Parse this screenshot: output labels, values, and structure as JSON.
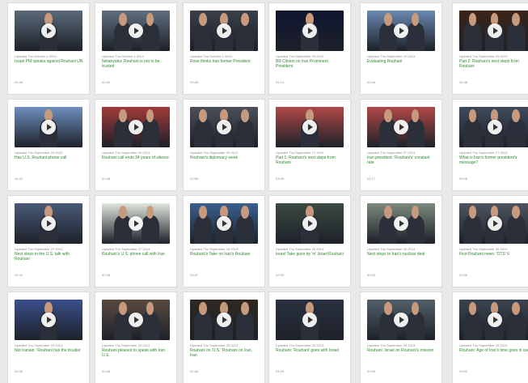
{
  "videos": [
    {
      "updated": "Updated Thu October 1 2013",
      "title": "Israel PM speaks against Rouhani UN",
      "duration": "01:48",
      "bg": "#5a6a7a"
    },
    {
      "updated": "Updated Thu October 1 2013",
      "title": "Netanyahu: Rouhani is not to be trusted",
      "duration": "02:30",
      "bg": "#5f6f7f"
    },
    {
      "updated": "Updated Thu October 1 2013",
      "title": "Rove thinks Iran former President",
      "duration": "03:45",
      "bg": "#3a3f48"
    },
    {
      "updated": "Updated Thu September 29 2013",
      "title": "Bill Clinton on Iran Prominent President",
      "duration": "02:14",
      "bg": "#0f1430"
    },
    {
      "updated": "Updated Thu September 29 2013",
      "title": "Evaluating Rouhani",
      "duration": "02:46",
      "bg": "#6a88b0"
    },
    {
      "updated": "Updated Thu September 29 2013",
      "title": "Part 2: Rouhani's next steps from Rouhani",
      "duration": "04:38",
      "bg": "#3c2418"
    },
    {
      "updated": "Updated Thu September 29 2013",
      "title": "Has U.S. Rouhani phone call",
      "duration": "01:42",
      "bg": "#6f8fbe"
    },
    {
      "updated": "Updated Thu September 29 2013",
      "title": "Rouhani call ends 34 years of silence",
      "duration": "01:48",
      "bg": "#a03a3a"
    },
    {
      "updated": "Updated Thu September 29 2013",
      "title": "Rouhani's diplomacy week",
      "duration": "01:56",
      "bg": "#4a4f58"
    },
    {
      "updated": "Updated Thu September 27 2013",
      "title": "Part 1: Rouhani's next steps from Rouhani",
      "duration": "03:45",
      "bg": "#b04848"
    },
    {
      "updated": "Updated Thu September 27 2013",
      "title": "Iran president: 'Rouhani's' constant rate",
      "duration": "01:17",
      "bg": "#b04848"
    },
    {
      "updated": "Updated Thu September 27 2013",
      "title": "What is Iran's former president's message?",
      "duration": "03:48",
      "bg": "#3e4a5c"
    },
    {
      "updated": "Updated Thu September 27 2013",
      "title": "Next steps in the U.S. talk with Rouhani",
      "duration": "01:44",
      "bg": "#4a5a78"
    },
    {
      "updated": "Updated Thu September 27 2013",
      "title": "Rouhani's U.S. phone call with Iran",
      "duration": "02:38",
      "bg": "#dfe6dc"
    },
    {
      "updated": "Updated Thu September 26 2013",
      "title": "Rouhani's Take on Iran's Rouhani",
      "duration": "03:47",
      "bg": "#3a5f8f"
    },
    {
      "updated": "Updated Thu September 26 2013",
      "title": "Israel Take goes by 'in' Israel Rouhani",
      "duration": "02:09",
      "bg": "#3c4a42"
    },
    {
      "updated": "Updated Thu September 26 2013",
      "title": "Next steps to Iran's nuclear deal",
      "duration": "02:40",
      "bg": "#7d8a7e"
    },
    {
      "updated": "Updated Thu September 26 2013",
      "title": "First Rouhani news: 'OTS' 6",
      "duration": "03:30",
      "bg": "#4e5560"
    },
    {
      "updated": "Updated Thu September 25 2013",
      "title": "Not Iranian: 'Rouhani has the trouble'",
      "duration": "02:26",
      "bg": "#3a4f8c"
    },
    {
      "updated": "Updated Thu September 25 2013",
      "title": "Rouhani pleased to speak with Iran U.S.",
      "duration": "02:48",
      "bg": "#5a4a40"
    },
    {
      "updated": "Updated Thu September 25 2013",
      "title": "Rouhani on 'U.S.' Rouhani on Iran, Iran",
      "duration": "02:46",
      "bg": "#2f2820"
    },
    {
      "updated": "Updated Thu September 25 2013",
      "title": "Rouhani: 'Rouhani' goes with Israel",
      "duration": "03:25",
      "bg": "#2a3040"
    },
    {
      "updated": "Updated Thu September 25 2013",
      "title": "Rouhani: Israel on Rouhani's mission",
      "duration": "03:30",
      "bg": "#53606a"
    },
    {
      "updated": "Updated Thu September 25 2013",
      "title": "Rouhani: Age of Iran's time goes in use",
      "duration": "03:32",
      "bg": "#3a4450"
    }
  ]
}
